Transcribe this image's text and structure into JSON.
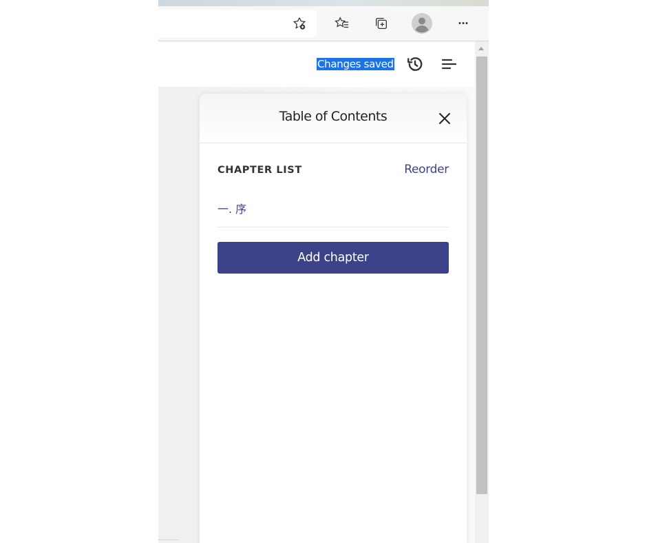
{
  "toolbar": {
    "icons": [
      "add-favorite-icon",
      "favorites-icon",
      "collections-icon",
      "profile-icon",
      "more-icon"
    ],
    "more_label": "···"
  },
  "header": {
    "status_text": "Changes saved",
    "icons": [
      "history-icon",
      "toc-menu-icon"
    ]
  },
  "toc": {
    "title": "Table of Contents",
    "section_label": "CHAPTER LIST",
    "reorder_label": "Reorder",
    "chapters": [
      {
        "label": "一. 序"
      }
    ],
    "add_button_label": "Add chapter"
  },
  "colors": {
    "accent": "#3c4288",
    "link": "#3d4289",
    "selection": "#1a73e8"
  }
}
